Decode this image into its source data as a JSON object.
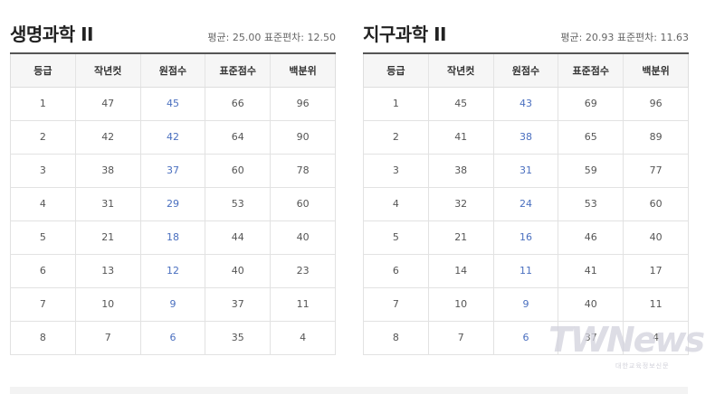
{
  "headers": [
    "등급",
    "작년컷",
    "원점수",
    "표준점수",
    "백분위"
  ],
  "left": {
    "title": "생명과학 II",
    "stats": "평균: 25.00 표준편차: 12.50",
    "rows": [
      [
        "1",
        "47",
        "45",
        "66",
        "96"
      ],
      [
        "2",
        "42",
        "42",
        "64",
        "90"
      ],
      [
        "3",
        "38",
        "37",
        "60",
        "78"
      ],
      [
        "4",
        "31",
        "29",
        "53",
        "60"
      ],
      [
        "5",
        "21",
        "18",
        "44",
        "40"
      ],
      [
        "6",
        "13",
        "12",
        "40",
        "23"
      ],
      [
        "7",
        "10",
        "9",
        "37",
        "11"
      ],
      [
        "8",
        "7",
        "6",
        "35",
        "4"
      ]
    ]
  },
  "right": {
    "title": "지구과학 II",
    "stats": "평균: 20.93 표준편차: 11.63",
    "rows": [
      [
        "1",
        "45",
        "43",
        "69",
        "96"
      ],
      [
        "2",
        "41",
        "38",
        "65",
        "89"
      ],
      [
        "3",
        "38",
        "31",
        "59",
        "77"
      ],
      [
        "4",
        "32",
        "24",
        "53",
        "60"
      ],
      [
        "5",
        "21",
        "16",
        "46",
        "40"
      ],
      [
        "6",
        "14",
        "11",
        "41",
        "17"
      ],
      [
        "7",
        "10",
        "9",
        "40",
        "11"
      ],
      [
        "8",
        "7",
        "6",
        "37",
        "4"
      ]
    ]
  },
  "watermark": {
    "logo": "TWNews",
    "sub": "대한교육정보신문"
  },
  "colors": {
    "raw_score": "#4a6fbf",
    "header_bg": "#f6f6f6",
    "title": "#222222"
  }
}
